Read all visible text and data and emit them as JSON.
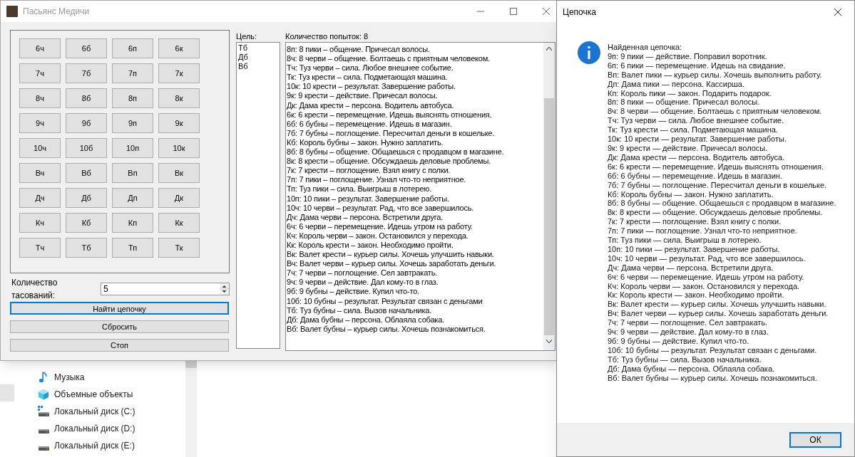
{
  "window": {
    "title": "Пасьянс Медичи"
  },
  "card_grid": [
    [
      "6ч",
      "6б",
      "6п",
      "6к"
    ],
    [
      "7ч",
      "7б",
      "7п",
      "7к"
    ],
    [
      "8ч",
      "8б",
      "8п",
      "8к"
    ],
    [
      "9ч",
      "9б",
      "9п",
      "9к"
    ],
    [
      "10ч",
      "10б",
      "10п",
      "10к"
    ],
    [
      "Вч",
      "Вб",
      "Вп",
      "Вк"
    ],
    [
      "Дч",
      "Дб",
      "Дп",
      "Дк"
    ],
    [
      "Кч",
      "Кб",
      "Кп",
      "Кк"
    ],
    [
      "Тч",
      "Тб",
      "Тп",
      "Тк"
    ]
  ],
  "target": {
    "label": "Цель:",
    "items": [
      "Тб",
      "Дб",
      "Вб"
    ]
  },
  "attempts": "Количество попыток: 8",
  "log": [
    "8п: 8 пики – общение. Причесал волосы.",
    "8ч: 8 черви – общение. Болтаешь с приятным человеком.",
    "Тч: Туз черви – сила. Любое внешнее событие.",
    "Тк: Туз крести – сила. Подметающая машина.",
    "10к: 10 крести – результат. Завершение работы.",
    "9к: 9 крести – действие. Причесал волосы.",
    "Дк: Дама крести – персона. Водитель автобуса.",
    "6к: 6 крести – перемещение. Идешь выяснять отношения.",
    "6б: 6 бубны – перемещение. Идешь в магазин.",
    "7б: 7 бубны – поглощение. Пересчитал деньги в кошельке.",
    "Кб: Король бубны – закон. Нужно заплатить.",
    "8б: 8 бубны – общение. Общаешься с продавцом в магазине.",
    "8к: 8 крести – общение. Обсуждаешь деловые проблемы.",
    "7к: 7 крести – поглощение. Взял книгу с полки.",
    "7п: 7 пики – поглощение. Узнал что-то неприятное.",
    "Тп: Туз пики – сила. Выигрыш в лотерею.",
    "10п: 10 пики – результат. Завершение работы.",
    "10ч: 10 черви – результат. Рад, что все завершилось.",
    "Дч: Дама черви – персона. Встретили друга.",
    "6ч: 6 черви – перемещение. Идешь утром на работу.",
    "Кч: Король черви – закон. Остановился у перехода.",
    "Кк: Король крести – закон. Необходимо пройти.",
    "Вк: Валет крести – курьер силы. Хочешь улучшить навыки.",
    "Вч: Валет черви – курьер силы. Хочешь заработать деньги.",
    "7ч: 7 черви – поглощение. Сел завтракать.",
    "9ч: 9 черви – действие. Дал кому-то в глаз.",
    "9б: 9 бубны – действие. Купил что-то.",
    "10б: 10 бубны – результат. Результат связан с деньгами",
    "Тб: Туз бубны – сила. Вызов начальника.",
    "Дб: Дама бубны – персона. Облаяла собака.",
    "Вб: Валет бубны – курьер силы. Хочешь познакомиться."
  ],
  "shuffles": {
    "label": "Количество тасований:",
    "value": "5"
  },
  "actions": [
    {
      "label": "Найти цепочку",
      "focused": true
    },
    {
      "label": "Сбросить",
      "focused": false
    },
    {
      "label": "Стоп",
      "focused": false
    }
  ],
  "explorer": [
    {
      "label": "Музыка",
      "kind": "music"
    },
    {
      "label": "Объемные объекты",
      "kind": "cube"
    },
    {
      "label": "Локальный диск (C:)",
      "kind": "system-drive"
    },
    {
      "label": "Локальный диск (D:)",
      "kind": "drive"
    },
    {
      "label": "Локальный диск (E:)",
      "kind": "drive"
    }
  ],
  "dialog": {
    "title": "Цепочка",
    "lines": [
      "Найденная цепочка:",
      "9п: 9 пики — действие. Поправил воротник.",
      "6п: 6 пики — перемещение. Идешь на свидание.",
      "Вп: Валет пики — курьер силы. Хочешь выполнить работу.",
      "Дп: Дама пики — персона. Кассирша.",
      "Кп: Король пики — закон. Подарить подарок.",
      "8п: 8 пики — общение. Причесал волосы.",
      "8ч: 8 черви — общение. Болтаешь с приятным человеком.",
      "Тч: Туз черви — сила. Любое внешнее событие.",
      "Тк: Туз крести — сила. Подметающая машина.",
      "10к: 10 крести — результат. Завершение работы.",
      "9к: 9 крести — действие. Причесал волосы.",
      "Дк: Дама крести — персона. Водитель автобуса.",
      "6к: 6 крести — перемещение. Идешь выяснять отношения.",
      "6б: 6 бубны — перемещение. Идешь в магазин.",
      "7б: 7 бубны — поглощение. Пересчитал деньги в кошельке.",
      "Кб: Король бубны — закон. Нужно заплатить.",
      "8б: 8 бубны — общение. Общаешься с продавцом в магазине.",
      "8к: 8 крести — общение. Обсуждаешь деловые проблемы.",
      "7к: 7 крести — поглощение. Взял книгу с полки.",
      "7п: 7 пики — поглощение. Узнал что-то неприятное.",
      "Тп: Туз пики — сила. Выигрыш в лотерею.",
      "10п: 10 пики — результат. Завершение работы.",
      "10ч: 10 черви — результат. Рад, что все завершилось.",
      "Дч: Дама черви — персона. Встретили друга.",
      "6ч: 6 черви — перемещение. Идешь утром на работу.",
      "Кч: Король черви — закон. Остановился у перехода.",
      "Кк: Король крести — закон. Необходимо пройти.",
      "Вк: Валет крести — курьер силы. Хочешь улучшить навыки.",
      "Вч: Валет черви — курьер силы. Хочешь заработать деньги.",
      "7ч: 7 черви — поглощение. Сел завтракать.",
      "9ч: 9 черви — действие. Дал кому-то в глаз.",
      "9б: 9 бубны — действие. Купил что-то.",
      "10б: 10 бубны — результат. Результат связан с деньгами.",
      "Тб: Туз бубны — сила. Вызов начальника.",
      "Дб: Дама бубны — персона. Облаяла собака.",
      "Вб: Валет бубны — курьер силы. Хочешь познакомиться."
    ],
    "ok": {
      "label": "ОК",
      "focused": true
    }
  }
}
